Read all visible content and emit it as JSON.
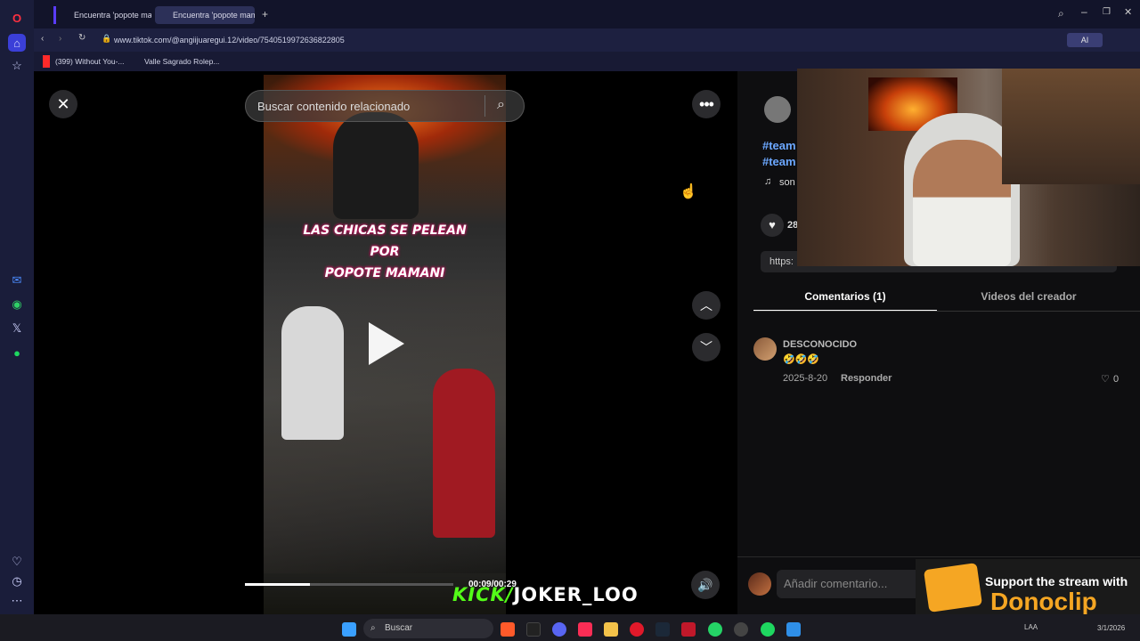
{
  "browser": {
    "tabs": [
      {
        "label": "Encuentra 'popote mama"
      },
      {
        "label": "Encuentra 'popote mama"
      }
    ],
    "url": "www.tiktok.com/@angiijuaregui.12/video/7540519972636822805",
    "bookmarks": [
      {
        "label": "(399) Without You-..."
      },
      {
        "label": "Valle Sagrado Rolep..."
      }
    ],
    "ai_label": "AI"
  },
  "tiktok": {
    "search_placeholder": "Buscar contenido relacionado",
    "video_caption_line1": "LAS CHICAS SE PELEAN POR",
    "video_caption_line2": "POPOTE MAMANI",
    "time": "00:09/00:29",
    "progress": 0.31,
    "hashtag1": "#team",
    "hashtag2": "#team",
    "sound": "son",
    "likes_partial": "28",
    "link_partial": "https:",
    "tabs": [
      {
        "label": "Comentarios (1)",
        "active": true
      },
      {
        "label": "Videos del creador",
        "active": false
      }
    ],
    "comment": {
      "author": "DESCONOCIDO",
      "emojis": "🤣🤣🤣",
      "date": "2025-8-20",
      "reply": "Responder",
      "likes": "0"
    },
    "comment_placeholder": "Añadir comentario..."
  },
  "overlay": {
    "kick_prefix": "KICK/",
    "kick_user": "JOKER_LOO",
    "dono_line1": "Support the stream with",
    "dono_brand": "Donoclip"
  },
  "taskbar": {
    "search": "Buscar",
    "lang": "LAA",
    "date": "3/1/2026"
  },
  "colors": {
    "accent_tiktok_link": "#6ca8ff",
    "kick_green": "#53fc18",
    "dono_orange": "#f5a623"
  }
}
